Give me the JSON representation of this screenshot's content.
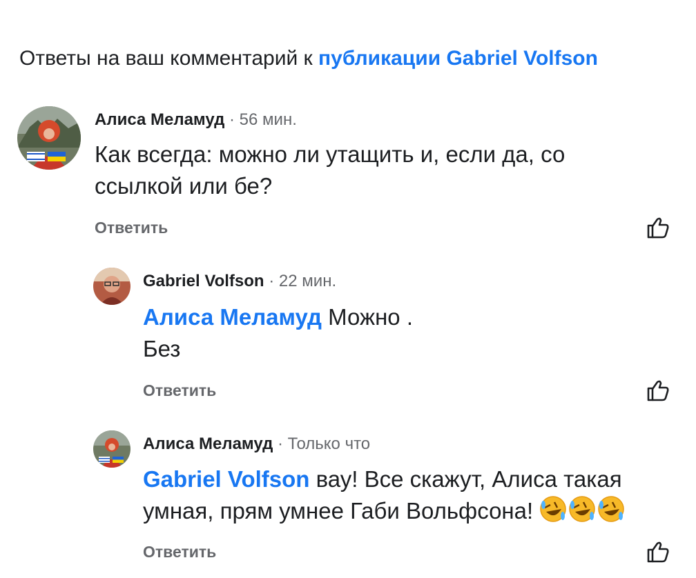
{
  "header": {
    "prefix": "Ответы на ваш комментарий к ",
    "link": "публикации Gabriel Volfson"
  },
  "comments": [
    {
      "author": "Алиса Меламуд",
      "time": "· 56 мин.",
      "text": "Как всегда: можно ли утащить и, если да, со ссылкой или бе?",
      "reply": "Ответить",
      "avatar": "user-avatar"
    },
    {
      "author": "Gabriel Volfson",
      "time": "· 22 мин.",
      "mention": "Алиса Меламуд",
      "text_line1": " Можно .",
      "text_line2": "Без",
      "reply": "Ответить",
      "avatar": "user-avatar"
    },
    {
      "author": "Алиса Меламуд",
      "time": "· Только что",
      "mention": "Gabriel Volfson",
      "text_line1": " вау! Все скажут, Алиса такая",
      "text_line2": "умная, прям умнее Габи Вольфсона! ",
      "emoji": "rolling-on-floor-laughing-emoji",
      "reply": "Ответить",
      "avatar": "user-avatar"
    }
  ],
  "colors": {
    "link": "#1877f2",
    "secondary": "#65676b",
    "text": "#1c1e21"
  },
  "icons": {
    "like": "thumbs-up-icon"
  }
}
